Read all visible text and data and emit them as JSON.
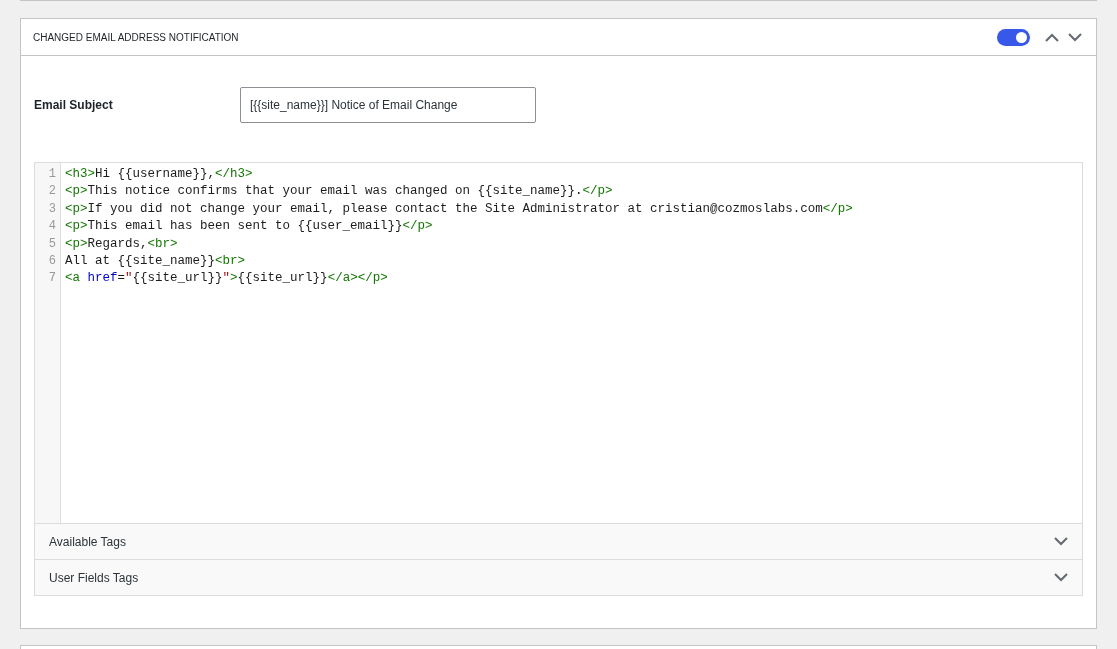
{
  "panel": {
    "title": "CHANGED EMAIL ADDRESS NOTIFICATION",
    "enabled": true
  },
  "subject": {
    "label": "Email Subject",
    "value": "[{{site_name}}] Notice of Email Change"
  },
  "editor": {
    "lines": [
      {
        "number": "1",
        "tokens": [
          {
            "kind": "tag",
            "text": "<h3>"
          },
          {
            "kind": "text",
            "text": "Hi {{username}},"
          },
          {
            "kind": "tag",
            "text": "</h3>"
          }
        ]
      },
      {
        "number": "2",
        "tokens": [
          {
            "kind": "tag",
            "text": "<p>"
          },
          {
            "kind": "text",
            "text": "This notice confirms that your email was changed on {{site_name}}."
          },
          {
            "kind": "tag",
            "text": "</p>"
          }
        ]
      },
      {
        "number": "3",
        "tokens": [
          {
            "kind": "tag",
            "text": "<p>"
          },
          {
            "kind": "text",
            "text": "If you did not change your email, please contact the Site Administrator at cristian@cozmoslabs.com"
          },
          {
            "kind": "tag",
            "text": "</p>"
          }
        ]
      },
      {
        "number": "4",
        "tokens": [
          {
            "kind": "tag",
            "text": "<p>"
          },
          {
            "kind": "text",
            "text": "This email has been sent to {{user_email}}"
          },
          {
            "kind": "tag",
            "text": "</p>"
          }
        ]
      },
      {
        "number": "5",
        "tokens": [
          {
            "kind": "tag",
            "text": "<p>"
          },
          {
            "kind": "text",
            "text": "Regards,"
          },
          {
            "kind": "tag",
            "text": "<br>"
          }
        ]
      },
      {
        "number": "6",
        "tokens": [
          {
            "kind": "text",
            "text": "All at {{site_name}}"
          },
          {
            "kind": "tag",
            "text": "<br>"
          }
        ]
      },
      {
        "number": "7",
        "tokens": [
          {
            "kind": "tag",
            "text": "<a "
          },
          {
            "kind": "attr",
            "text": "href"
          },
          {
            "kind": "text",
            "text": "="
          },
          {
            "kind": "string",
            "text": "\""
          },
          {
            "kind": "text",
            "text": "{{site_url}}"
          },
          {
            "kind": "string",
            "text": "\""
          },
          {
            "kind": "tag",
            "text": ">"
          },
          {
            "kind": "text",
            "text": "{{site_url}}"
          },
          {
            "kind": "tag",
            "text": "</a></p>"
          }
        ]
      }
    ]
  },
  "accordions": [
    {
      "label": "Available Tags",
      "expanded": false
    },
    {
      "label": "User Fields Tags",
      "expanded": false
    }
  ]
}
